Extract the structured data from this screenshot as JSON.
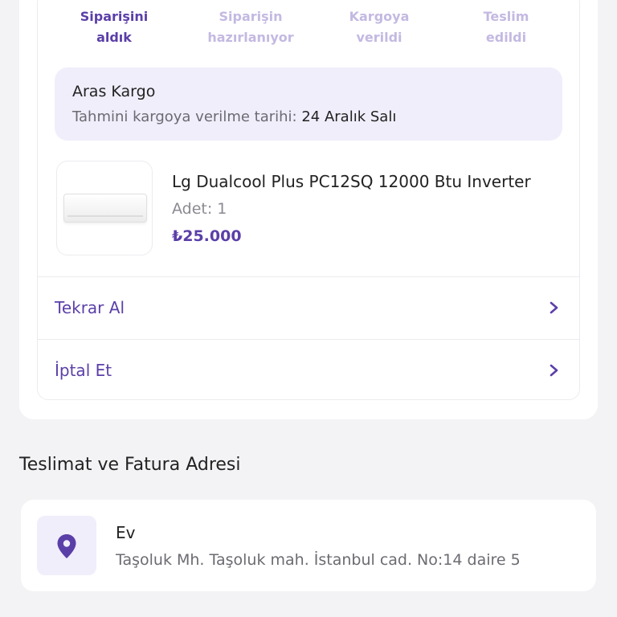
{
  "order_status": {
    "steps": [
      {
        "line1": "Siparişini",
        "line2": "aldık",
        "state": "active"
      },
      {
        "line1": "Siparişin",
        "line2": "hazırlanıyor",
        "state": "inactive"
      },
      {
        "line1": "Kargoya",
        "line2": "verildi",
        "state": "inactive"
      },
      {
        "line1": "Teslim",
        "line2": "edildi",
        "state": "inactive"
      }
    ]
  },
  "shipping": {
    "carrier": "Aras Kargo",
    "eta_label": "Tahmini kargoya verilme tarihi:",
    "eta_value": "24 Aralık Salı"
  },
  "product": {
    "name": "Lg Dualcool Plus PC12SQ 12000 Btu Inverter",
    "quantity": "Adet: 1",
    "price": "₺25.000",
    "image_icon": "air-conditioner-image"
  },
  "actions": {
    "reorder_label": "Tekrar Al",
    "cancel_label": "İptal Et"
  },
  "address_section": {
    "title": "Teslimat ve Fatura Adresi",
    "name": "Ev",
    "address": "Taşoluk Mh.  Taşoluk mah. İstanbul cad. No:14 daire 5",
    "icon": "location-pin-icon"
  },
  "colors": {
    "accent": "#5b3fa8",
    "accent_light": "#c4b9e2",
    "panel_bg": "#f0eefb",
    "page_bg": "#f3f3f5"
  }
}
